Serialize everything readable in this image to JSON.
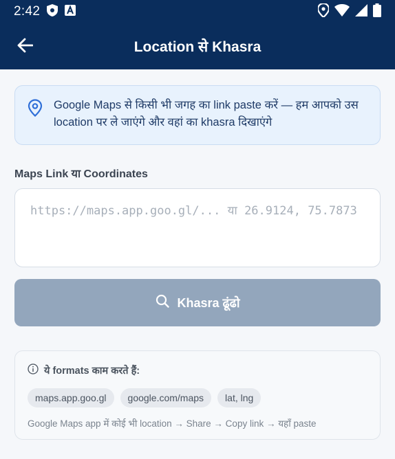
{
  "status_bar": {
    "time": "2:42"
  },
  "toolbar": {
    "title": "Location से Khasra"
  },
  "info_card": {
    "text": "Google Maps से किसी भी जगह का link paste करें — हम आपको उस location पर ले जाएंगे और वहां का khasra दिखाएंगे"
  },
  "input": {
    "label": "Maps Link या Coordinates",
    "placeholder": "https://maps.app.goo.gl/... या 26.9124, 75.7873",
    "value": ""
  },
  "search_button": {
    "label": "Khasra ढूंढो"
  },
  "formats": {
    "heading": "ये formats काम करते हैं:",
    "chips": [
      "maps.app.goo.gl",
      "google.com/maps",
      "lat, lng"
    ],
    "hint": "Google Maps app में कोई भी location → Share → Copy link → यहाँ paste"
  },
  "colors": {
    "appbar": "#0a2d5c",
    "button_disabled": "#93a6bc",
    "info_bg": "#e8f2fd",
    "accent": "#2f6fd8"
  }
}
